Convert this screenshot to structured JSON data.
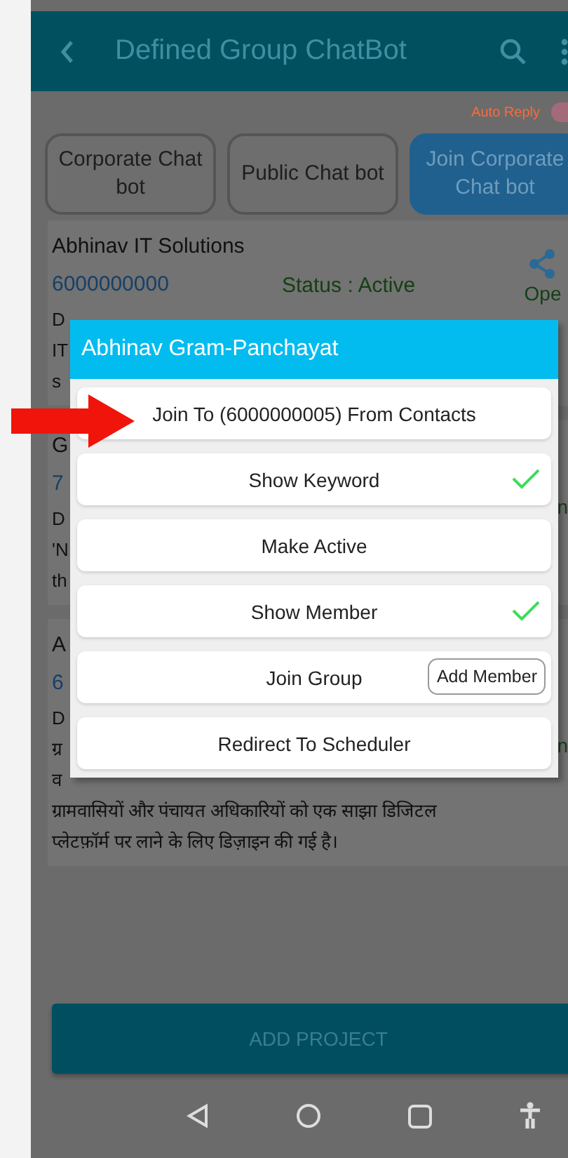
{
  "header": {
    "title": "Defined Group ChatBot"
  },
  "auto_reply": {
    "label": "Auto Reply",
    "on": true
  },
  "tabs": [
    {
      "label": "Corporate Chat bot",
      "selected": false
    },
    {
      "label": "Public Chat bot",
      "selected": false
    },
    {
      "label": "Join Corporate Chat bot",
      "selected": true
    }
  ],
  "cards": [
    {
      "title": "Abhinav IT Solutions",
      "phone": "6000000000",
      "status": "Status : Active",
      "side_label": "Ope",
      "share": true,
      "lines": [
        "D",
        "IT",
        "s"
      ]
    },
    {
      "title": "G",
      "phone": "7",
      "side_label": "n",
      "share": false,
      "lines": [
        "D",
        "'N",
        "th"
      ]
    },
    {
      "title": "A",
      "phone": "6",
      "side_label": "n",
      "share": false,
      "lines": [
        "D",
        "ग्र",
        "व",
        "ग्रामवासियों और पंचायत अधिकारियों को एक साझा डिजिटल",
        "प्लेटफ़ॉर्म पर लाने के लिए डिज़ाइन की गई है।"
      ]
    }
  ],
  "dialog": {
    "title": "Abhinav Gram-Panchayat",
    "options": [
      {
        "label": "Join To (6000000005) From Contacts",
        "checked": false
      },
      {
        "label": "Show Keyword",
        "checked": true
      },
      {
        "label": "Make Active",
        "checked": false
      },
      {
        "label": "Show Member",
        "checked": true
      },
      {
        "label": "Join Group",
        "checked": false,
        "action": "Add Member"
      },
      {
        "label": "Redirect To Scheduler",
        "checked": false
      }
    ]
  },
  "add_button": "ADD PROJECT"
}
